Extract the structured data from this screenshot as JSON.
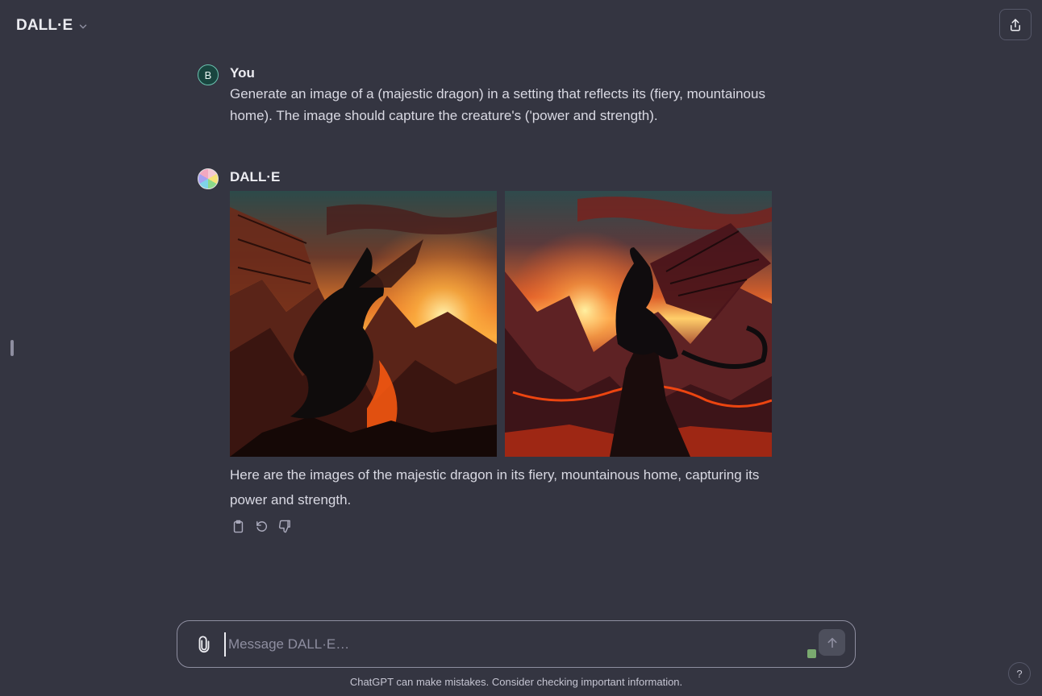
{
  "header": {
    "model_name": "DALL·E",
    "icons": {
      "model_switch": "chevron-down-icon",
      "share": "share-icon"
    }
  },
  "conversation": {
    "user_message": {
      "author": "You",
      "avatar_letter": "B",
      "text": "Generate an image of a (majestic dragon) in a setting that reflects its (fiery, mountainous home). The image should capture the creature's ('power and strength)."
    },
    "assistant_message": {
      "author": "DALL·E",
      "images": [
        {
          "subject": "dragon perched on crag facing right, sunset over volcanic mountains"
        },
        {
          "subject": "dragon perched on crag facing left, sunset over lava-filled valley"
        }
      ],
      "text": "Here are the images of the majestic dragon in its fiery, mountainous home, capturing its power and strength.",
      "action_icons": [
        "copy-icon",
        "regenerate-icon",
        "thumbs-down-icon"
      ]
    }
  },
  "composer": {
    "placeholder": "Message DALL·E…",
    "icons": {
      "attach": "paperclip-icon",
      "send": "arrow-up-icon"
    }
  },
  "footer": {
    "disclaimer": "ChatGPT can make mistakes. Consider checking important information.",
    "help_label": "?"
  },
  "colors": {
    "background": "#343541",
    "text_primary": "#ececf1",
    "text_secondary": "#d9d9e3",
    "border": "#8e8ea0"
  }
}
